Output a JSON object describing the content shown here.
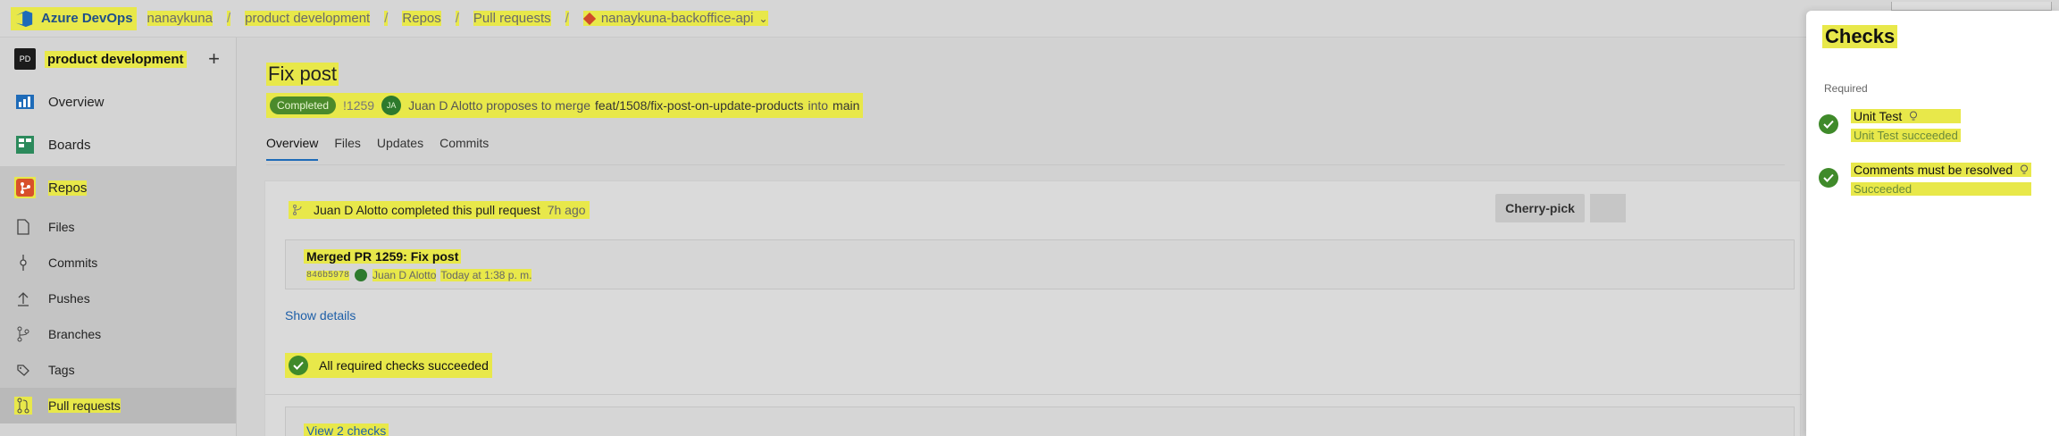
{
  "topbar": {
    "brand": "Azure DevOps",
    "breadcrumbs": [
      "nanaykuna",
      "product development",
      "Repos",
      "Pull requests"
    ],
    "separator": "/",
    "repo": "nanaykuna-backoffice-api"
  },
  "sidebar": {
    "project_initials": "PD",
    "project_name": "product development",
    "add_label": "+",
    "items": [
      {
        "label": "Overview",
        "icon": "overview-icon"
      },
      {
        "label": "Boards",
        "icon": "boards-icon"
      },
      {
        "label": "Repos",
        "icon": "repos-icon"
      }
    ],
    "repo_items": [
      {
        "label": "Files",
        "icon": "files-icon"
      },
      {
        "label": "Commits",
        "icon": "commits-icon"
      },
      {
        "label": "Pushes",
        "icon": "pushes-icon"
      },
      {
        "label": "Branches",
        "icon": "branches-icon"
      },
      {
        "label": "Tags",
        "icon": "tags-icon"
      },
      {
        "label": "Pull requests",
        "icon": "pull-requests-icon"
      }
    ]
  },
  "pr": {
    "title": "Fix post",
    "status": "Completed",
    "id": "!1259",
    "author_initials": "JA",
    "author_text": "Juan D Alotto proposes to merge",
    "source_branch": "feat/1508/fix-post-on-update-products",
    "into": "into",
    "target_branch": "main"
  },
  "tabs": [
    "Overview",
    "Files",
    "Updates",
    "Commits"
  ],
  "overview": {
    "completed_text": "Juan D Alotto completed this pull request",
    "completed_ago": "7h ago",
    "cherry_pick": "Cherry-pick",
    "merge_commit_title": "Merged PR 1259: Fix post",
    "commit_hash": "846b5978",
    "commit_author": "Juan D Alotto",
    "commit_time": "Today at 1:38 p. m.",
    "show_details": "Show details",
    "checks_summary": "All required checks succeeded",
    "view_checks": "View 2 checks"
  },
  "checks_panel": {
    "title": "Checks",
    "section": "Required",
    "items": [
      {
        "name": "Unit Test",
        "status": "Unit Test succeeded"
      },
      {
        "name": "Comments must be resolved",
        "status": "Succeeded"
      }
    ]
  },
  "colors": {
    "highlight": "#e8e84a",
    "success": "#3f8a2a",
    "link": "#1e5fa8",
    "tab_underline": "#1e6bb8"
  }
}
